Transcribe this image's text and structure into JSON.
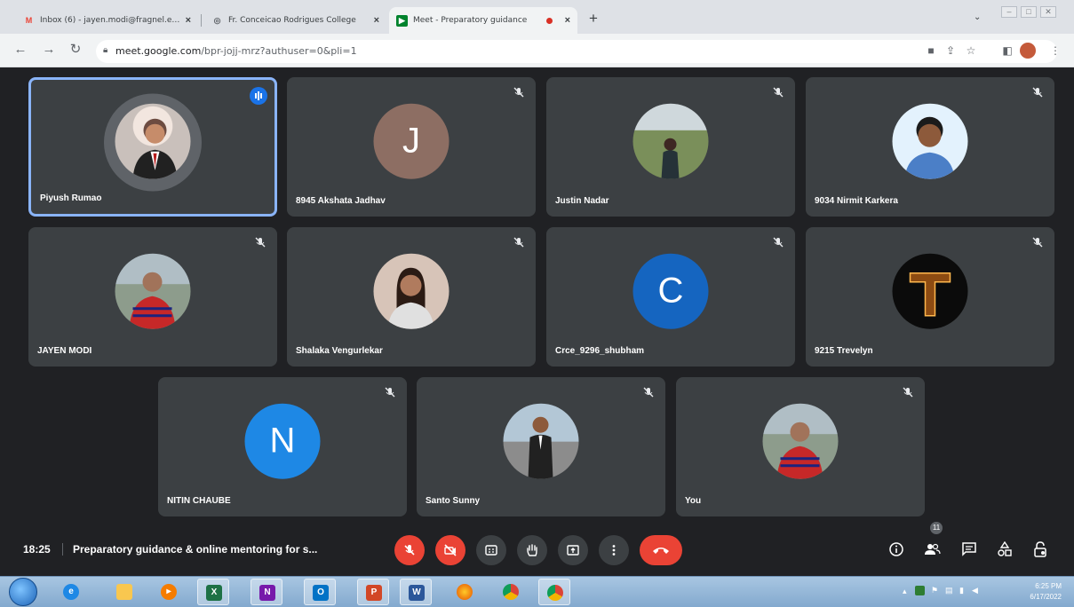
{
  "browser": {
    "tabs": [
      {
        "title": "Inbox (6) - jayen.modi@fragnel.edu.in",
        "active": false,
        "icon": "gmail-icon"
      },
      {
        "title": "Fr. Conceicao Rodrigues College",
        "active": false,
        "icon": "globe-icon"
      },
      {
        "title": "Meet - Preparatory guidance",
        "active": true,
        "icon": "meet-icon",
        "recording": true
      }
    ],
    "new_tab": "+",
    "url_host": "meet.google.com",
    "url_path": "/bpr-jojj-mrz?authuser=0&pli=1"
  },
  "meet": {
    "participants": [
      {
        "name": "Piyush Rumao",
        "type": "photo",
        "speaking": true,
        "muted": false
      },
      {
        "name": "8945 Akshata Jadhav",
        "type": "letter",
        "letter": "J",
        "color": "#8d6e63",
        "muted": true
      },
      {
        "name": "Justin Nadar",
        "type": "photo",
        "muted": true
      },
      {
        "name": "9034 Nirmit Karkera",
        "type": "photo",
        "muted": true
      },
      {
        "name": "JAYEN MODI",
        "type": "photo",
        "muted": true
      },
      {
        "name": "Shalaka Vengurlekar",
        "type": "photo",
        "muted": true
      },
      {
        "name": "Crce_9296_shubham",
        "type": "letter",
        "letter": "C",
        "color": "#1565c0",
        "muted": true
      },
      {
        "name": "9215 Trevelyn",
        "type": "photo",
        "muted": true
      },
      {
        "name": "NITIN CHAUBE",
        "type": "letter",
        "letter": "N",
        "color": "#1e88e5",
        "muted": true
      },
      {
        "name": "Santo Sunny",
        "type": "photo",
        "muted": true
      },
      {
        "name": "You",
        "type": "photo",
        "muted": true
      }
    ],
    "clock": "18:25",
    "separator": "|",
    "meeting_title": "Preparatory guidance & online mentoring for s...",
    "participant_count": "11",
    "colors": {
      "bg": "#202124",
      "tile": "#3c4043",
      "danger": "#ea4335",
      "accent": "#8ab4f8"
    }
  },
  "taskbar": {
    "time": "6:25 PM",
    "date": "6/17/2022"
  }
}
